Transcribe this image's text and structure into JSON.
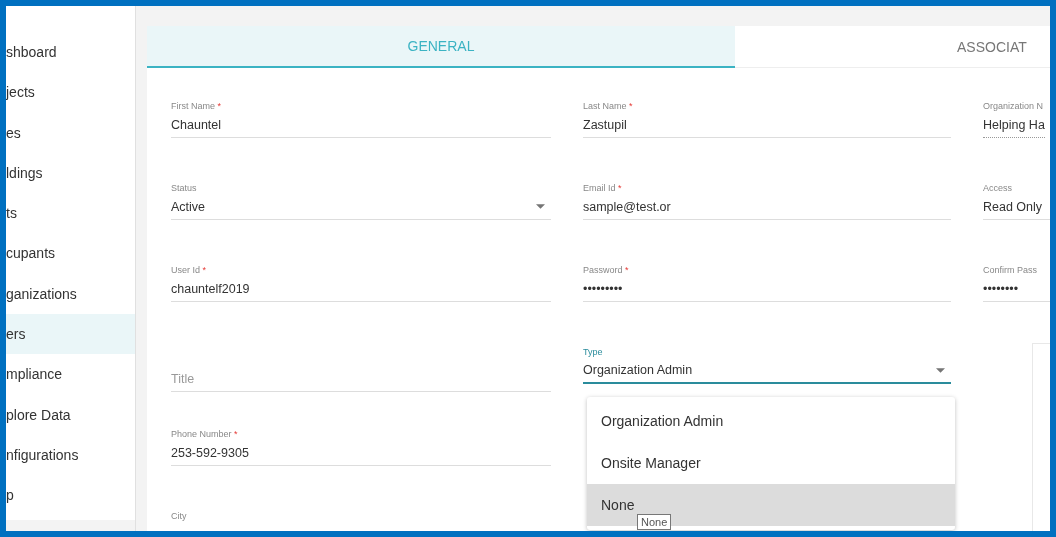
{
  "sidebar": {
    "items": [
      {
        "label": "shboard",
        "selected": false
      },
      {
        "label": "jects",
        "selected": false
      },
      {
        "label": "es",
        "selected": false
      },
      {
        "label": "ldings",
        "selected": false
      },
      {
        "label": "ts",
        "selected": false
      },
      {
        "label": "cupants",
        "selected": false
      },
      {
        "label": "ganizations",
        "selected": false
      },
      {
        "label": "ers",
        "selected": true
      },
      {
        "label": "mpliance",
        "selected": false
      },
      {
        "label": "plore Data",
        "selected": false
      },
      {
        "label": "nfigurations",
        "selected": false
      },
      {
        "label": "p",
        "selected": false
      }
    ]
  },
  "tabs": [
    {
      "label": "GENERAL",
      "selected": true
    },
    {
      "label": "ASSOCIAT",
      "selected": false
    }
  ],
  "form": {
    "rows": [
      {
        "fields": [
          {
            "kind": "text",
            "label": "First Name",
            "marker": "*",
            "value": "Chauntel"
          },
          {
            "kind": "text",
            "label": "Last Name",
            "marker": "*",
            "value": "Zastupil"
          },
          {
            "kind": "readonly",
            "label": "Organization N",
            "value": "Helping Ha"
          }
        ]
      },
      {
        "fields": [
          {
            "kind": "select",
            "label": "Status",
            "value": "Active"
          },
          {
            "kind": "text",
            "label": "Email Id",
            "marker": "*",
            "value": "sample@test.or"
          },
          {
            "kind": "text",
            "label": "Access",
            "value": "Read Only"
          }
        ]
      },
      {
        "fields": [
          {
            "kind": "text",
            "label": "User Id",
            "marker": "*",
            "value": "chauntelf2019"
          },
          {
            "kind": "text",
            "label": "Password",
            "marker": "*",
            "value": "•••••••••"
          },
          {
            "kind": "text",
            "label": "Confirm Pass",
            "value": "••••••••"
          }
        ]
      },
      {
        "fields": [
          {
            "kind": "text",
            "placeholder": "Title"
          },
          {
            "kind": "select",
            "label": "Type",
            "value": "Organization Admin",
            "focused": true
          },
          {
            "kind": "blank"
          }
        ]
      },
      {
        "fields": [
          {
            "kind": "text",
            "label": "Phone Number",
            "marker": "*",
            "value": "253-592-9305"
          },
          {
            "kind": "blank"
          },
          {
            "kind": "blank"
          }
        ]
      },
      {
        "fields": [
          {
            "kind": "label-only",
            "label": "City"
          },
          {
            "kind": "blank"
          },
          {
            "kind": "blank"
          }
        ]
      }
    ]
  },
  "dropdown": {
    "options": [
      {
        "label": "Organization Admin",
        "highlighted": false
      },
      {
        "label": "Onsite Manager",
        "highlighted": false
      },
      {
        "label": "None",
        "highlighted": true
      }
    ],
    "tooltip": "None"
  }
}
